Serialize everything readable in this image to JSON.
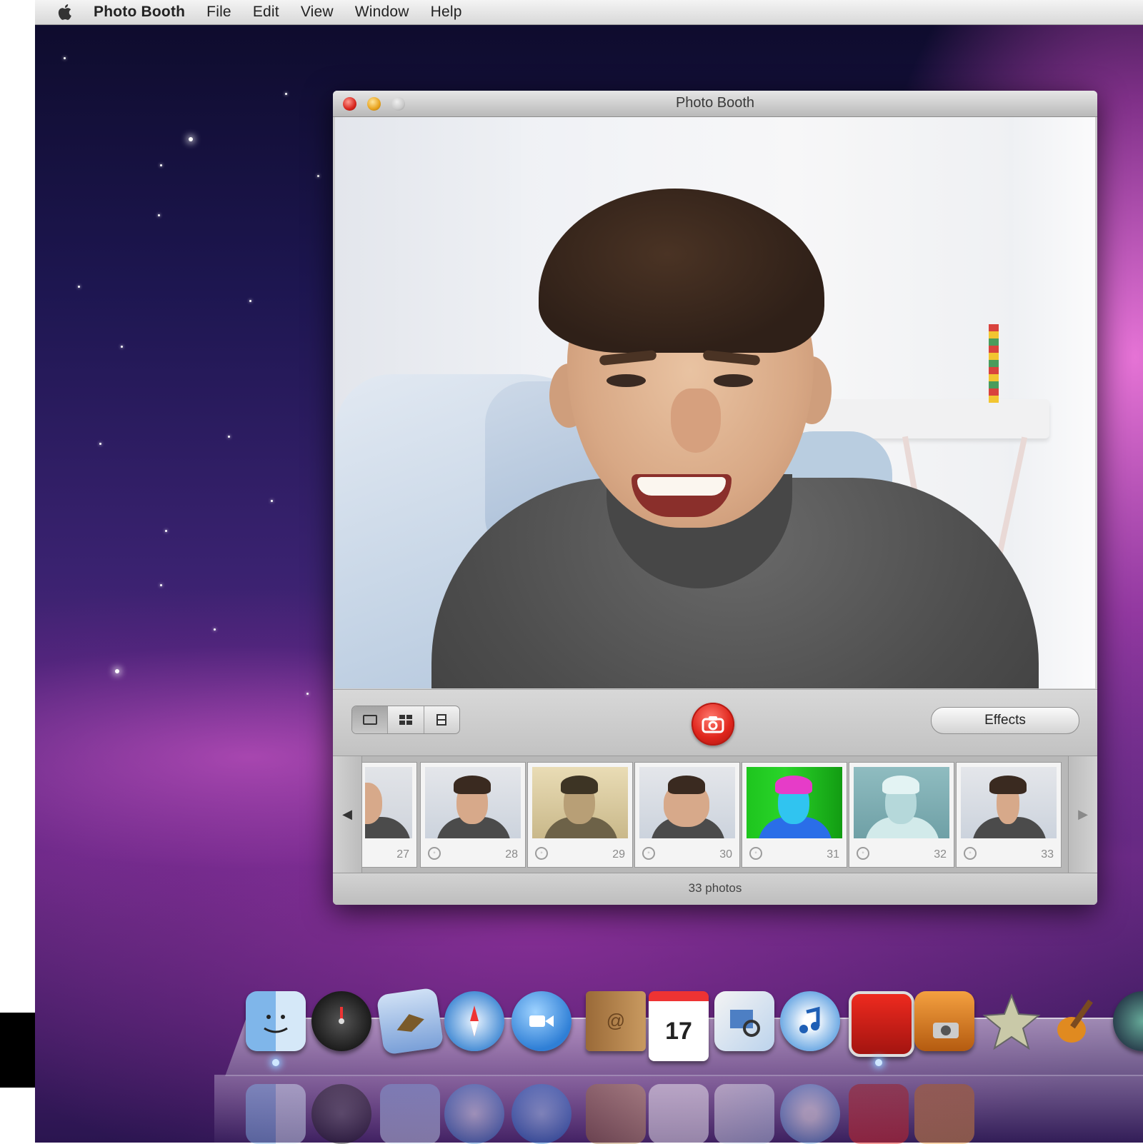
{
  "menubar": {
    "apple": "apple-logo-icon",
    "app_name": "Photo Booth",
    "items": [
      "File",
      "Edit",
      "View",
      "Window",
      "Help"
    ]
  },
  "window": {
    "title": "Photo Booth",
    "controls": {
      "close": "close-button",
      "minimize": "minimize-button",
      "zoom": "zoom-button"
    }
  },
  "toolbar": {
    "view_modes": [
      "single-photo-icon",
      "four-up-icon",
      "movie-clip-icon"
    ],
    "active_mode": 0,
    "shutter_icon": "camera-icon",
    "effects_label": "Effects"
  },
  "filmstrip": {
    "thumbnails": [
      {
        "number": "27",
        "style": "normal"
      },
      {
        "number": "28",
        "style": "normal"
      },
      {
        "number": "29",
        "style": "sepia"
      },
      {
        "number": "30",
        "style": "bulge"
      },
      {
        "number": "31",
        "style": "thermal"
      },
      {
        "number": "32",
        "style": "xray"
      },
      {
        "number": "33",
        "style": "squeeze"
      }
    ]
  },
  "status": {
    "count_label": "33 photos"
  },
  "dock": {
    "items": [
      "finder-icon",
      "dashboard-icon",
      "mail-icon",
      "safari-icon",
      "ichat-icon",
      "address-book-icon",
      "ical-icon",
      "preview-icon",
      "itunes-icon",
      "photo-booth-icon",
      "iphoto-icon",
      "imovie-icon",
      "garageband-icon",
      "time-machine-icon"
    ],
    "calendar_day": "17"
  },
  "colors": {
    "shutter_red": "#e0261d",
    "desktop_purple": "#6a2a85"
  }
}
